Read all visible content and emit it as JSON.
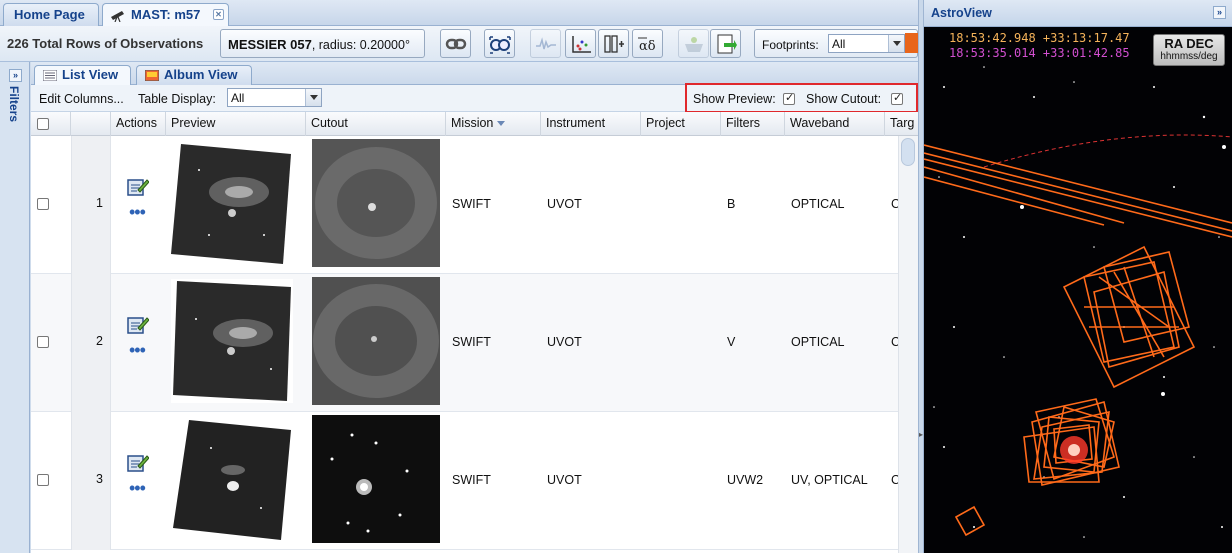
{
  "tabs": [
    {
      "label": "Home Page"
    },
    {
      "label": "MAST: m57"
    }
  ],
  "toolbar": {
    "rows_label": "226 Total Rows of Observations",
    "target_name": "MESSIER 057",
    "target_radius": ", radius: 0.20000°",
    "footprints_label": "Footprints:",
    "footprints_value": "All"
  },
  "sidebar": {
    "filters_label": "Filters"
  },
  "view_tabs": [
    {
      "label": "List View"
    },
    {
      "label": "Album View"
    }
  ],
  "subbar": {
    "edit_columns": "Edit Columns...",
    "table_display_label": "Table Display:",
    "table_display_value": "All",
    "show_preview_label": "Show Preview:",
    "show_preview_checked": true,
    "show_cutout_label": "Show Cutout:",
    "show_cutout_checked": true
  },
  "columns": [
    "Actions",
    "Preview",
    "Cutout",
    "Mission",
    "Instrument",
    "Project",
    "Filters",
    "Waveband",
    "Targ"
  ],
  "rows": [
    {
      "num": "1",
      "mission": "SWIFT",
      "instrument": "UVOT",
      "project": "",
      "filters": "B",
      "waveband": "OPTICAL",
      "target": "C"
    },
    {
      "num": "2",
      "mission": "SWIFT",
      "instrument": "UVOT",
      "project": "",
      "filters": "V",
      "waveband": "OPTICAL",
      "target": "C"
    },
    {
      "num": "3",
      "mission": "SWIFT",
      "instrument": "UVOT",
      "project": "",
      "filters": "UVW2",
      "waveband": "UV, OPTICAL",
      "target": "C"
    }
  ],
  "astroview": {
    "title": "AstroView",
    "coord_primary": "18:53:42.948 +33:13:17.47",
    "coord_secondary": "18:53:35.014 +33:01:42.85",
    "frame_label": "RA DEC",
    "frame_units": "hhmmss/deg"
  },
  "colors": {
    "accent": "#15428b",
    "footprint": "#ff6a1a",
    "highlight": "#e0282c"
  }
}
